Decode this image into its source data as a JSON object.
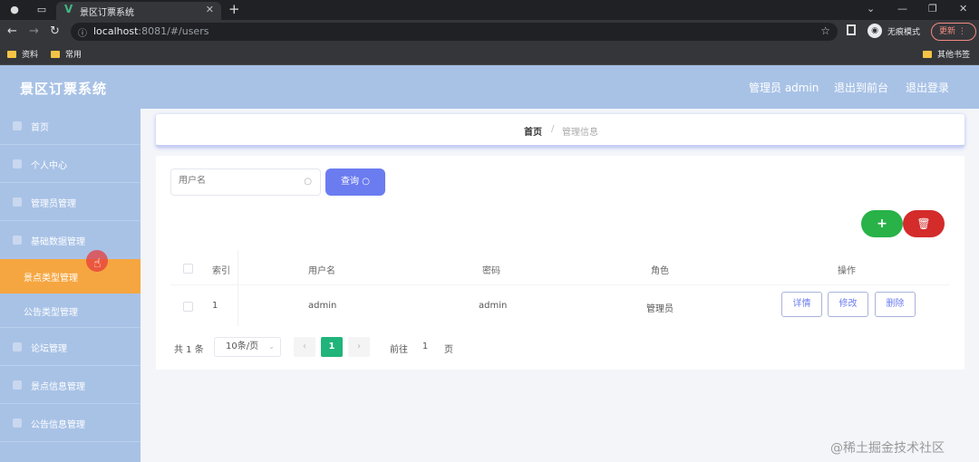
{
  "browser": {
    "tab_title": "景区订票系统",
    "url_host": "localhost",
    "url_path": ":8081/#/users",
    "incognito_label": "无痕模式",
    "update_label": "更新",
    "bookmarks": [
      "资料",
      "常用"
    ],
    "other_bookmarks": "其他书签"
  },
  "header": {
    "title": "景区订票系统",
    "user": "管理员 admin",
    "backend_link": "退出到前台",
    "logout_link": "退出登录"
  },
  "sidebar": {
    "items": [
      {
        "label": "首页"
      },
      {
        "label": "个人中心"
      },
      {
        "label": "管理员管理"
      },
      {
        "label": "基础数据管理"
      },
      {
        "label": "景点类型管理",
        "active": true
      },
      {
        "label": "公告类型管理"
      },
      {
        "label": "论坛管理"
      },
      {
        "label": "景点信息管理"
      },
      {
        "label": "公告信息管理"
      }
    ]
  },
  "breadcrumb": {
    "home": "首页",
    "separator": "/",
    "current": "管理信息"
  },
  "search": {
    "placeholder": "用户名",
    "button_label": "查询"
  },
  "table": {
    "headers": [
      "索引",
      "用户名",
      "密码",
      "角色",
      "操作"
    ],
    "rows": [
      {
        "index": "1",
        "username": "admin",
        "password": "admin",
        "role": "管理员"
      }
    ],
    "actions": [
      "详情",
      "修改",
      "删除"
    ]
  },
  "pagination": {
    "total": "共 1 条",
    "page_size": "10条/页",
    "current_page": "1",
    "goto_label": "前往",
    "goto_value": "1",
    "page_unit": "页"
  },
  "watermark": "@稀土掘金技术社区",
  "colors": {
    "header_bg": "#a8c2e6",
    "active_menu": "#f6a640",
    "primary_button": "#6b7cf0",
    "add_button": "#28b248",
    "delete_button": "#d42b2b",
    "current_page": "#20b47a"
  }
}
